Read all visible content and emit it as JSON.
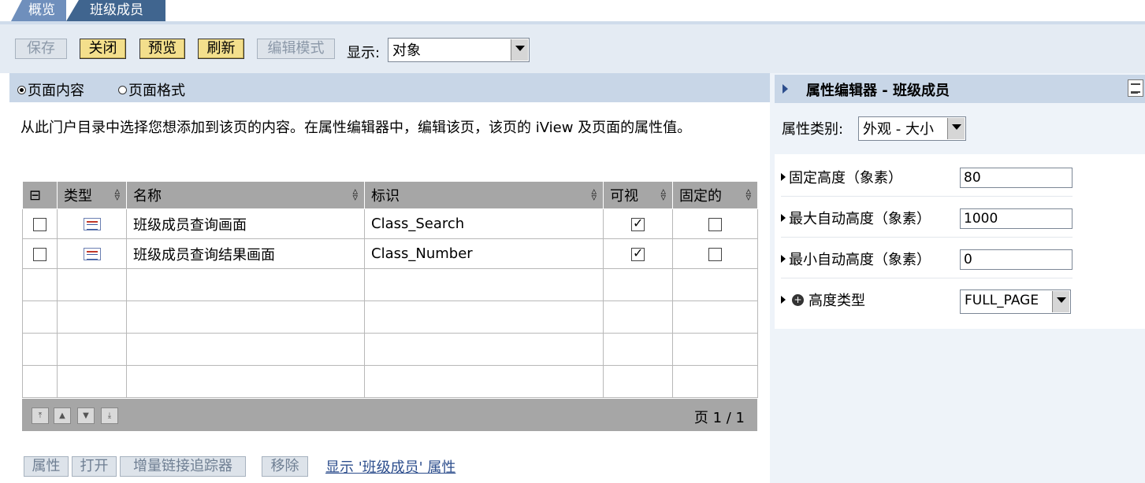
{
  "tabs": [
    {
      "label": "概览"
    },
    {
      "label": "班级成员"
    }
  ],
  "toolbar": {
    "save": "保存",
    "close": "关闭",
    "preview": "预览",
    "refresh": "刷新",
    "edit_mode": "编辑模式",
    "show_label": "显示:",
    "show_value": "对象"
  },
  "content": {
    "radio_content": "页面内容",
    "radio_format": "页面格式",
    "description": "从此门户目录中选择您想添加到该页的内容。在属性编辑器中，编辑该页，该页的 iView 及页面的属性值。"
  },
  "table": {
    "headers": {
      "type": "类型",
      "name": "名称",
      "id": "标识",
      "visible": "可视",
      "fixed": "固定的"
    },
    "rows": [
      {
        "name": "班级成员查询画面",
        "id": "Class_Search",
        "visible": true,
        "fixed": false
      },
      {
        "name": "班级成员查询结果画面",
        "id": "Class_Number",
        "visible": true,
        "fixed": false
      }
    ],
    "page_info": "页 1 / 1"
  },
  "bottom": {
    "properties": "属性",
    "open": "打开",
    "tracker": "增量链接追踪器",
    "remove": "移除",
    "link": "显示 '班级成员' 属性"
  },
  "editor": {
    "title": "属性编辑器 - 班级成员",
    "category_label": "属性类别:",
    "category_value": "外观 - 大小",
    "props": [
      {
        "label": "固定高度（象素）",
        "value": "80"
      },
      {
        "label": "最大自动高度（象素）",
        "value": "1000"
      },
      {
        "label": "最小自动高度（象素）",
        "value": "0"
      },
      {
        "label": "高度类型",
        "value": "FULL_PAGE"
      }
    ]
  },
  "icons": {
    "doc": "iview-document-icon",
    "info": "info-icon",
    "menu": "panel-menu-icon"
  }
}
